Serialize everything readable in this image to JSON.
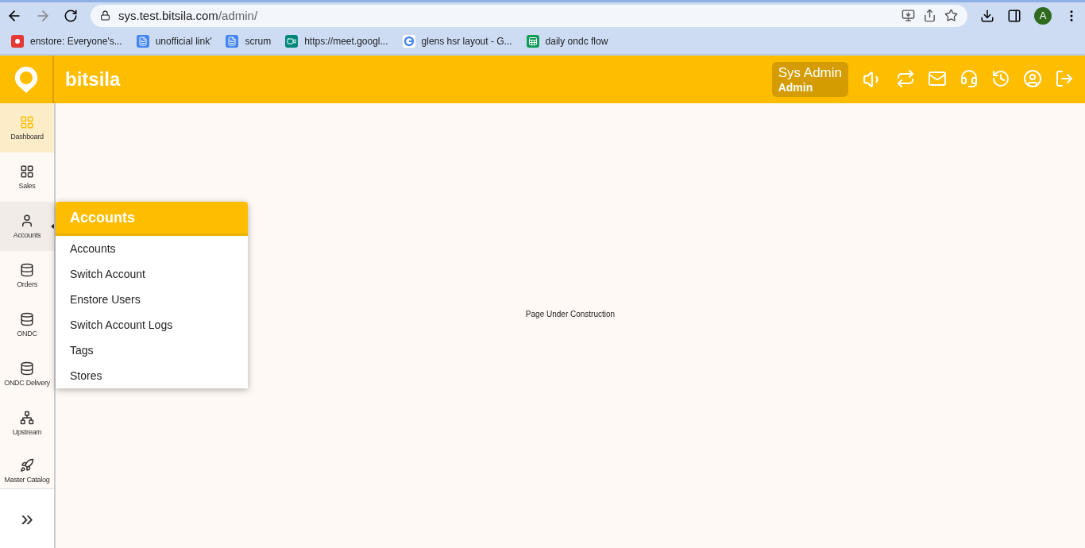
{
  "browser": {
    "url_host": "sys.test.bitsila.com",
    "url_path": "/admin/",
    "profile_initial": "A"
  },
  "bookmarks": [
    {
      "label": "enstore: Everyone's...",
      "kind": "logo"
    },
    {
      "label": "unofficial link'",
      "kind": "doc"
    },
    {
      "label": "scrum",
      "kind": "doc"
    },
    {
      "label": "https://meet.googl...",
      "kind": "meet"
    },
    {
      "label": "glens hsr layout - G...",
      "kind": "google"
    },
    {
      "label": "daily ondc flow",
      "kind": "sheet"
    }
  ],
  "header": {
    "brand": "bitsila",
    "user_name": "Sys Admin",
    "user_role": "Admin"
  },
  "sidebar": {
    "items": [
      {
        "label": "Dashboard",
        "kind": "grid",
        "selected": true,
        "expanded": false
      },
      {
        "label": "Sales",
        "kind": "grid",
        "selected": false,
        "expanded": false
      },
      {
        "label": "Accounts",
        "kind": "user",
        "selected": false,
        "expanded": true
      },
      {
        "label": "Orders",
        "kind": "database",
        "selected": false,
        "expanded": false
      },
      {
        "label": "ONDC",
        "kind": "database",
        "selected": false,
        "expanded": false
      },
      {
        "label": "ONDC Delivery",
        "kind": "database",
        "selected": false,
        "expanded": false
      },
      {
        "label": "Upstream",
        "kind": "network",
        "selected": false,
        "expanded": false
      },
      {
        "label": "Master Catalog",
        "kind": "rocket",
        "selected": false,
        "expanded": false
      }
    ],
    "expand_label": "»"
  },
  "flyout": {
    "title": "Accounts",
    "items": [
      "Accounts",
      "Switch Account",
      "Enstore Users",
      "Switch Account Logs",
      "Tags",
      "Stores"
    ]
  },
  "main": {
    "message": "Page Under Construction"
  }
}
